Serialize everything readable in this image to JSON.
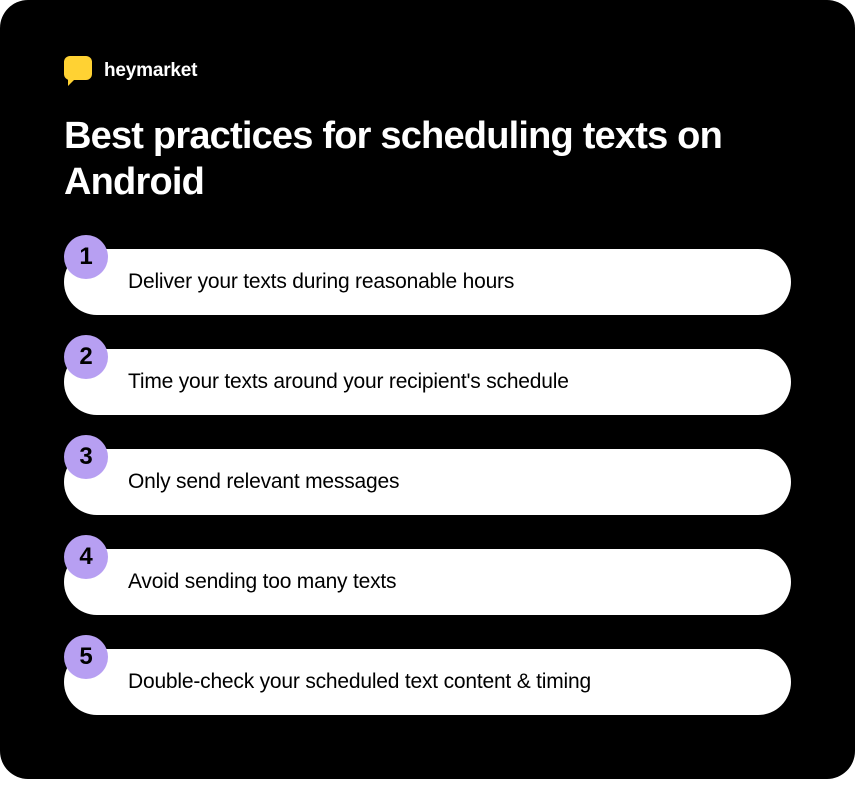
{
  "brand": {
    "name": "heymarket"
  },
  "title": "Best practices for scheduling texts on Android",
  "items": [
    {
      "num": "1",
      "text": "Deliver your texts during reasonable hours"
    },
    {
      "num": "2",
      "text": "Time your texts around your recipient's schedule"
    },
    {
      "num": "3",
      "text": "Only send relevant messages"
    },
    {
      "num": "4",
      "text": "Avoid sending too many texts"
    },
    {
      "num": "5",
      "text": "Double-check your scheduled text content & timing"
    }
  ]
}
